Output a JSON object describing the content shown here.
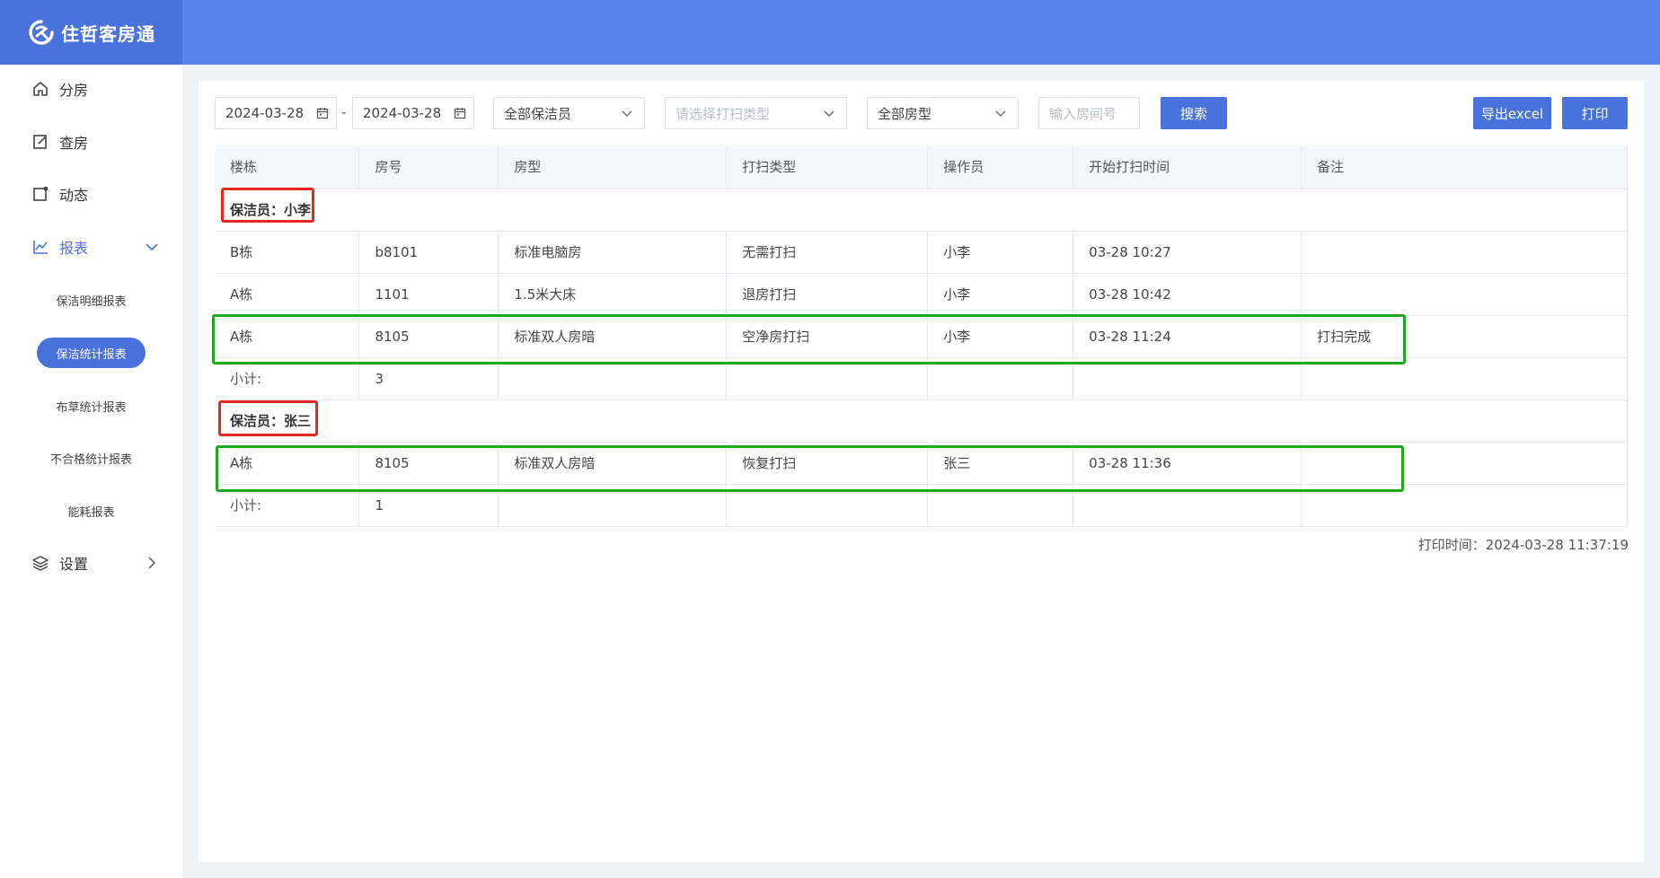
{
  "app": {
    "name": "住哲客房通",
    "brand_color": "#4a72dd",
    "header_color": "#5b83ec"
  },
  "sidebar": {
    "items": [
      {
        "label": "分房",
        "icon": "home-icon"
      },
      {
        "label": "查房",
        "icon": "edit-icon"
      },
      {
        "label": "动态",
        "icon": "square-icon"
      },
      {
        "label": "报表",
        "icon": "chart-line-icon",
        "expanded": true
      },
      {
        "label": "设置",
        "icon": "layers-icon"
      }
    ],
    "report_sub": [
      {
        "label": "保洁明细报表"
      },
      {
        "label": "保洁统计报表",
        "active": true
      },
      {
        "label": "布草统计报表"
      },
      {
        "label": "不合格统计报表"
      },
      {
        "label": "能耗报表"
      }
    ]
  },
  "filters": {
    "start_date": "2024-03-28",
    "end_date": "2024-03-28",
    "separator": "-",
    "cleaner": "全部保洁员",
    "clean_type_placeholder": "请选择打扫类型",
    "room_type": "全部房型",
    "room_no_placeholder": "输入房间号",
    "search_label": "搜索",
    "export_label": "导出excel",
    "print_label": "打印"
  },
  "table": {
    "headers": [
      "楼栋",
      "房号",
      "房型",
      "打扫类型",
      "操作员",
      "开始打扫时间",
      "备注"
    ],
    "groups": [
      {
        "title": "保洁员：小李",
        "rows": [
          [
            "B栋",
            "b8101",
            "标准电脑房",
            "无需打扫",
            "小李",
            "03-28 10:27",
            ""
          ],
          [
            "A栋",
            "1101",
            "1.5米大床",
            "退房打扫",
            "小李",
            "03-28 10:42",
            ""
          ],
          [
            "A栋",
            "8105",
            "标准双人房暗",
            "空净房打扫",
            "小李",
            "03-28 11:24",
            "打扫完成"
          ]
        ],
        "subtotal_label": "小计:",
        "subtotal": "3"
      },
      {
        "title": "保洁员：张三",
        "rows": [
          [
            "A栋",
            "8105",
            "标准双人房暗",
            "恢复打扫",
            "张三",
            "03-28 11:36",
            ""
          ]
        ],
        "subtotal_label": "小计:",
        "subtotal": "1"
      }
    ]
  },
  "print_time": "打印时间：2024-03-28 11:37:19"
}
